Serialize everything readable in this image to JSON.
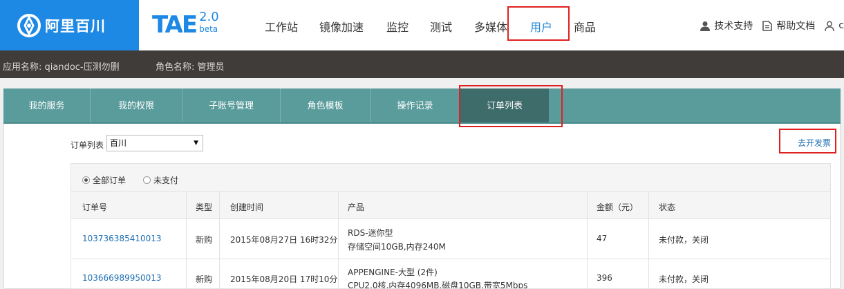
{
  "brand": {
    "name": "阿里百川"
  },
  "product": {
    "name": "TAE",
    "version": "2.0",
    "tag": "beta"
  },
  "nav": [
    {
      "label": "工作站"
    },
    {
      "label": "镜像加速"
    },
    {
      "label": "监控"
    },
    {
      "label": "测试"
    },
    {
      "label": "多媒体"
    },
    {
      "label": "用户",
      "active": true
    },
    {
      "label": "商品"
    }
  ],
  "header_links": {
    "support": "技术支持",
    "docs": "帮助文档"
  },
  "info": {
    "app": "应用名称: qiandoc-压测勿删",
    "role": "角色名称: 管理员"
  },
  "tabs": [
    {
      "label": "我的服务"
    },
    {
      "label": "我的权限"
    },
    {
      "label": "子账号管理"
    },
    {
      "label": "角色模板"
    },
    {
      "label": "操作记录"
    },
    {
      "label": "订单列表",
      "active": true
    }
  ],
  "filter": {
    "label": "订单列表",
    "selected": "百川",
    "invoice_link": "去开发票"
  },
  "radios": [
    {
      "label": "全部订单",
      "checked": true
    },
    {
      "label": "未支付",
      "checked": false
    }
  ],
  "table": {
    "headers": [
      "订单号",
      "类型",
      "创建时间",
      "产品",
      "金额（元）",
      "状态"
    ],
    "rows": [
      {
        "order_id": "103736385410013",
        "type": "新购",
        "created": "2015年08月27日 16时32分",
        "product_line1": "RDS-迷你型",
        "product_line2": "存储空间10GB,内存240M",
        "amount": "47",
        "status": "未付款，关闭"
      },
      {
        "order_id": "103666989950013",
        "type": "新购",
        "created": "2015年08月20日 17时10分",
        "product_line1": "APPENGINE-大型 (2件)",
        "product_line2": "CPU2.0核,内存4096MB,磁盘10GB,带宽5Mbps",
        "amount": "396",
        "status": "未付款，关闭"
      }
    ]
  },
  "colors": {
    "brand_blue": "#1e88e5",
    "tab_teal": "#5a9b9b",
    "tab_active": "#3e6c6a",
    "highlight": "#e02020",
    "link": "#1f6fb5"
  }
}
